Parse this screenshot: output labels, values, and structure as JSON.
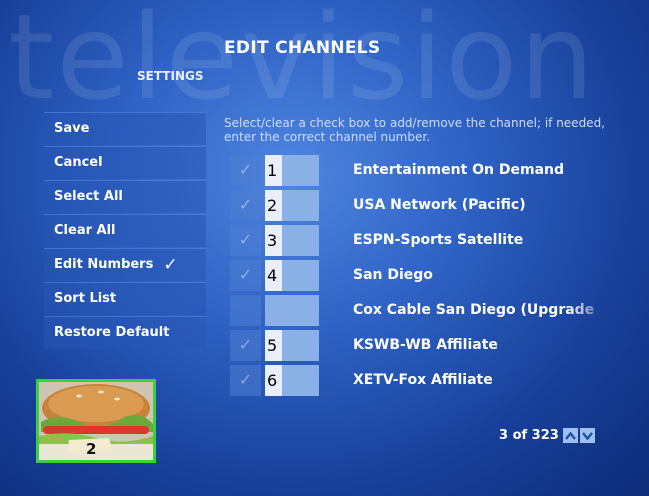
{
  "background_word": "television",
  "header": {
    "title": "EDIT CHANNELS",
    "section": "SETTINGS"
  },
  "menu": [
    {
      "label": "Save"
    },
    {
      "label": "Cancel"
    },
    {
      "label": "Select All"
    },
    {
      "label": "Clear All"
    },
    {
      "label": "Edit Numbers",
      "checked": true,
      "check_glyph": "✓"
    },
    {
      "label": "Sort List"
    },
    {
      "label": "Restore Default"
    }
  ],
  "instructions": "Select/clear a check box to add/remove the channel; if needed, enter the correct channel number.",
  "checkbox_glyph": "✓",
  "channels": [
    {
      "checked": true,
      "number": "1",
      "name": "Entertainment On Demand"
    },
    {
      "checked": true,
      "number": "2",
      "name": "USA Network (Pacific)"
    },
    {
      "checked": true,
      "number": "3",
      "name": "ESPN-Sports Satellite"
    },
    {
      "checked": true,
      "number": "4",
      "name": "San Diego"
    },
    {
      "checked": false,
      "number": "",
      "name": "Cox Cable San Diego (Upgrade"
    },
    {
      "checked": true,
      "number": "5",
      "name": "KSWB-WB Affiliate"
    },
    {
      "checked": true,
      "number": "6",
      "name": "XETV-Fox Affiliate"
    }
  ],
  "pager": {
    "text": "3 of 323",
    "up_icon": "arrow-up-icon",
    "down_icon": "arrow-down-icon"
  },
  "preview": {
    "channel_number": "2"
  },
  "colors": {
    "background": "#2e62c4",
    "preview_border": "#3bd043",
    "number_field": "#8ab0e6"
  }
}
